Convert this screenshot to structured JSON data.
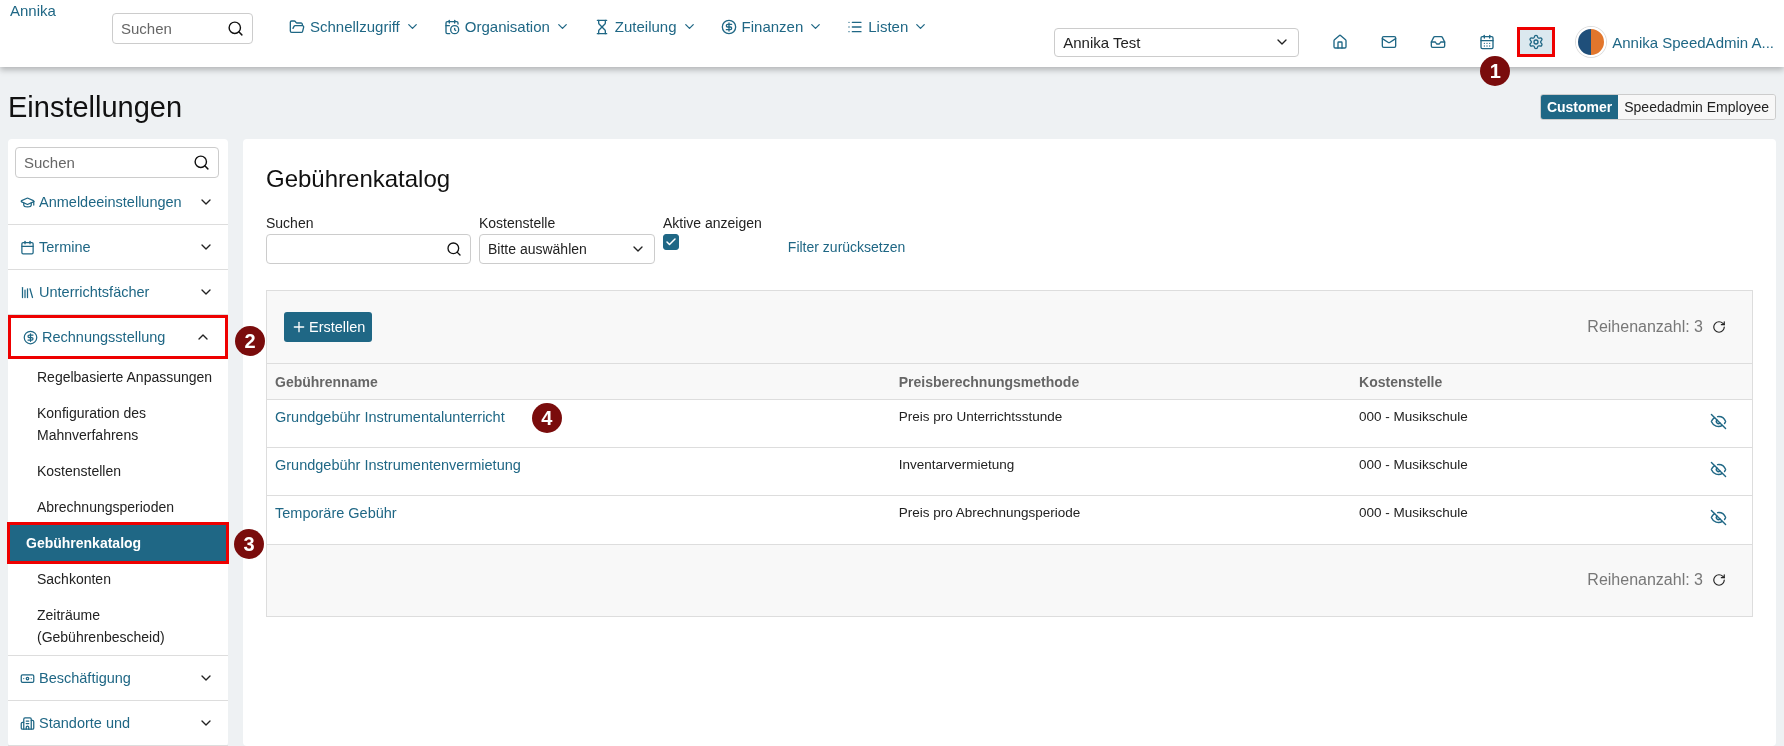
{
  "header": {
    "logo_alt": "Annika",
    "search": {
      "placeholder": "Suchen"
    },
    "nav": [
      {
        "label": "Schnellzugriff"
      },
      {
        "label": "Organisation"
      },
      {
        "label": "Zuteilung"
      },
      {
        "label": "Finanzen"
      },
      {
        "label": "Listen"
      }
    ],
    "org_select": {
      "value": "Annika Test"
    },
    "icons": [
      {
        "selected": false,
        "highlighted": false
      },
      {
        "selected": false,
        "highlighted": false
      },
      {
        "selected": false,
        "highlighted": false
      },
      {
        "selected": false,
        "highlighted": false
      },
      {
        "selected": true,
        "highlighted": true,
        "callout": "1"
      }
    ],
    "user": {
      "name": "Annika SpeedAdmin A..."
    }
  },
  "page": {
    "title": "Einstellungen",
    "view_toggle": [
      {
        "label": "Customer",
        "selected": true
      },
      {
        "label": "Speedadmin Employee",
        "selected": false
      }
    ]
  },
  "sidebar": {
    "search": {
      "placeholder": "Suchen"
    },
    "sections": [
      {
        "label": "Anmeldeeinstellungen",
        "expanded": false,
        "highlighted": false
      },
      {
        "label": "Termine",
        "expanded": false,
        "highlighted": false
      },
      {
        "label": "Unterrichtsfächer",
        "expanded": false,
        "highlighted": false
      },
      {
        "label": "Rechnungsstellung",
        "expanded": true,
        "highlighted": true,
        "callout": "2",
        "children": [
          {
            "label": "Regelbasierte Anpassungen",
            "selected": false,
            "highlighted": false
          },
          {
            "label": "Konfiguration des Mahnverfahrens",
            "selected": false,
            "highlighted": false
          },
          {
            "label": "Kostenstellen",
            "selected": false,
            "highlighted": false
          },
          {
            "label": "Abrechnungsperioden",
            "selected": false,
            "highlighted": false
          },
          {
            "label": "Gebührenkatalog",
            "selected": true,
            "highlighted": true,
            "callout": "3"
          },
          {
            "label": "Sachkonten",
            "selected": false,
            "highlighted": false
          },
          {
            "label": "Zeiträume (Gebührenbescheid)",
            "selected": false,
            "highlighted": false
          }
        ]
      },
      {
        "label": "Beschäftigung",
        "expanded": false,
        "highlighted": false
      },
      {
        "label": "Standorte und",
        "expanded": false,
        "highlighted": false
      }
    ]
  },
  "content": {
    "title": "Gebührenkatalog",
    "filters": {
      "search_label": "Suchen",
      "cost_center_label": "Kostenstelle",
      "cost_center_value": "Bitte auswählen",
      "active_label": "Aktive anzeigen",
      "active_checked": true,
      "reset_link": "Filter zurücksetzen"
    },
    "create_button": "Erstellen",
    "row_count_top": "Reihenanzahl: 3",
    "row_count_bottom": "Reihenanzahl: 3",
    "table": {
      "columns": [
        "Gebührenname",
        "Preisberechnungsmethode",
        "Kostenstelle"
      ],
      "rows": [
        {
          "name": "Grundgebühr Instrumentalunterricht",
          "method": "Preis pro Unterrichtsstunde",
          "cost_center": "000 - Musikschule",
          "callout": "4"
        },
        {
          "name": "Grundgebühr Instrumentenvermietung",
          "method": "Inventarvermietung",
          "cost_center": "000 - Musikschule"
        },
        {
          "name": "Temporäre Gebühr",
          "method": "Preis pro Abrechnungsperiode",
          "cost_center": "000 - Musikschule"
        }
      ]
    }
  }
}
